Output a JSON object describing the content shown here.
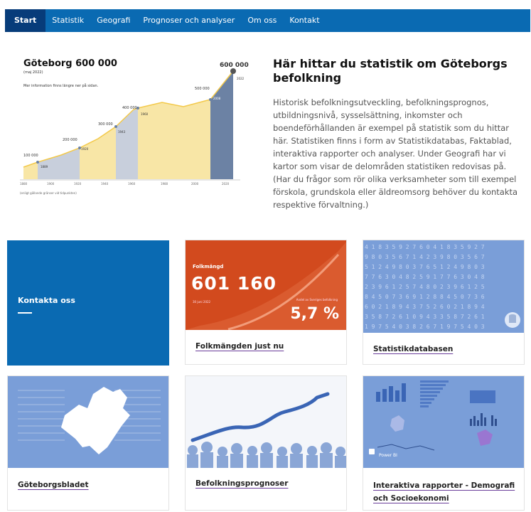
{
  "nav": {
    "items": [
      {
        "label": "Start",
        "active": true
      },
      {
        "label": "Statistik"
      },
      {
        "label": "Geografi"
      },
      {
        "label": "Prognoser och analyser"
      },
      {
        "label": "Om oss"
      },
      {
        "label": "Kontakt"
      }
    ]
  },
  "hero_chart": {
    "title": "Göteborg 600 000",
    "subtitle": "(maj 2022)",
    "info": "Mer information finns längre ner på sidan.",
    "footnote": "(enligt gällande gränser vid tidpunkten)",
    "milestones": [
      "100 000",
      "200 000",
      "300 000",
      "400 000",
      "500 000",
      "600 000"
    ],
    "milestone_years": [
      "1889",
      "1920",
      "1943",
      "1960",
      "2008",
      "2022"
    ],
    "axis_years": [
      "1880",
      "1900",
      "1920",
      "1940",
      "1960",
      "1980",
      "2000",
      "2020"
    ],
    "colors": {
      "yellow": "#f8e6a6",
      "gray": "#c8cfdc",
      "dark": "#6c82a4",
      "line": "#f3c94a"
    }
  },
  "hero": {
    "heading": "Här hittar du statistik om Göteborgs befolkning",
    "text": "Historisk befolkningsutveckling, befolkningsprognos, utbildningsnivå, sysselsättning, inkomster och boendeförhållanden är exempel på statistik som du hittar här. Statistiken finns i form av Statistikdatabas, Faktablad, interaktiva rapporter och analyser. Under Geografi har vi kartor som visar de delområden statistiken redovisas på. (Har du frågor som rör olika verksamheter som till exempel förskola, grundskola eller äldreomsorg behöver du kontakta respektive förvaltning.)"
  },
  "cards": {
    "contact": {
      "label": "Kontakta oss"
    },
    "folkmangd": {
      "img_label": "Folkmängd",
      "number": "601 160",
      "date": "30 juni 2022",
      "andel_label": "Andel av Sveriges befolkning",
      "percent": "5,7 %",
      "link": "Folkmängden just nu"
    },
    "statdb": {
      "link": "Statistikdatabasen"
    },
    "gbgbladet": {
      "link": "Göteborgsbladet"
    },
    "prognos": {
      "link": "Befolkningsprognoser"
    },
    "interaktiva": {
      "link": "Interaktiva rapporter - Demografi och Socioekonomi",
      "powerbi": "Power BI"
    }
  },
  "colors": {
    "brand_blue": "#0a6ab2",
    "nav_active": "#073c7a",
    "folkmangd_red": "#d24a1e",
    "card_lightblue": "#7a9ed8"
  }
}
